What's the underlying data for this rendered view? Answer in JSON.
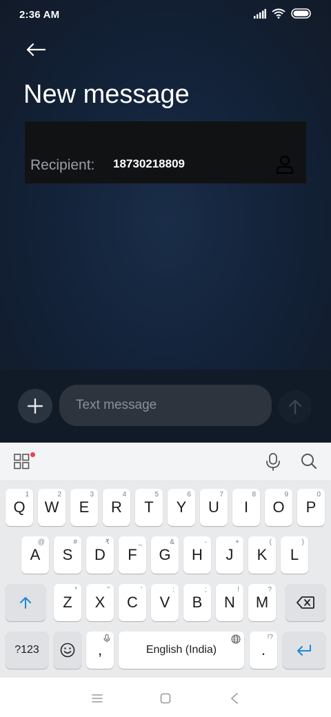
{
  "status_bar": {
    "time": "2:36 AM",
    "icons": [
      "signal-icon",
      "wifi-icon",
      "battery-icon"
    ]
  },
  "header": {
    "title": "New message",
    "back_icon": "arrow-left-icon"
  },
  "recipient": {
    "label": "Recipient:",
    "value": "18730218809",
    "contact_icon": "person-icon"
  },
  "composer": {
    "placeholder": "Text message",
    "add_icon": "plus-icon",
    "send_icon": "arrow-up-icon"
  },
  "keyboard": {
    "toolbar": {
      "apps_icon": "grid-icon",
      "mic_icon": "mic-icon",
      "search_icon": "search-icon"
    },
    "row1": [
      {
        "label": "Q",
        "hint": "1"
      },
      {
        "label": "W",
        "hint": "2"
      },
      {
        "label": "E",
        "hint": "3"
      },
      {
        "label": "R",
        "hint": "4"
      },
      {
        "label": "T",
        "hint": "5"
      },
      {
        "label": "Y",
        "hint": "6"
      },
      {
        "label": "U",
        "hint": "7"
      },
      {
        "label": "I",
        "hint": "8"
      },
      {
        "label": "O",
        "hint": "9"
      },
      {
        "label": "P",
        "hint": "0"
      }
    ],
    "row2": [
      {
        "label": "A",
        "hint": "@"
      },
      {
        "label": "S",
        "hint": "#"
      },
      {
        "label": "D",
        "hint": "₹"
      },
      {
        "label": "F",
        "hint": "_"
      },
      {
        "label": "G",
        "hint": "&"
      },
      {
        "label": "H",
        "hint": "-"
      },
      {
        "label": "J",
        "hint": "+"
      },
      {
        "label": "K",
        "hint": "("
      },
      {
        "label": "L",
        "hint": ")"
      }
    ],
    "row3": [
      {
        "label": "Z",
        "hint": "*"
      },
      {
        "label": "X",
        "hint": "\""
      },
      {
        "label": "C",
        "hint": "'"
      },
      {
        "label": "V",
        "hint": ":"
      },
      {
        "label": "B",
        "hint": ";"
      },
      {
        "label": "N",
        "hint": "!"
      },
      {
        "label": "M",
        "hint": "?"
      }
    ],
    "symbols_label": "?123",
    "comma_label": ",",
    "space_label": "English (India)",
    "period_label": ".",
    "period_hint": "!?"
  },
  "nav_bar": {
    "icons": [
      "menu-icon",
      "home-icon",
      "back-nav-icon"
    ]
  }
}
